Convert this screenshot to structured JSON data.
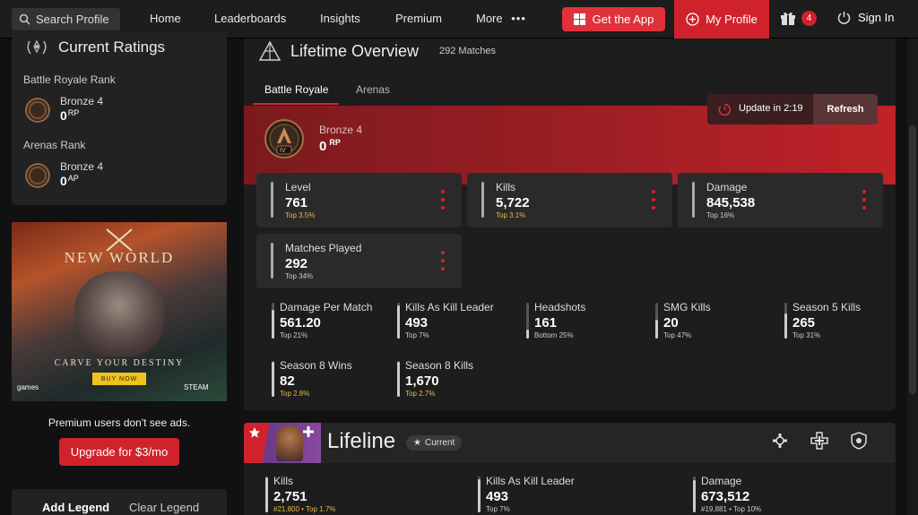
{
  "nav": {
    "search_label": "Search Profile",
    "links": [
      "Home",
      "Leaderboards",
      "Insights",
      "Premium",
      "More"
    ],
    "get_app": "Get the App",
    "my_profile": "My Profile",
    "gift_count": "4",
    "sign_in": "Sign In"
  },
  "sidebar": {
    "ratings_title": "Current Ratings",
    "br_label": "Battle Royale Rank",
    "br_rank": "Bronze 4",
    "br_value": "0",
    "br_unit": "RP",
    "arenas_label": "Arenas Rank",
    "arenas_rank": "Bronze 4",
    "arenas_value": "0",
    "arenas_unit": "AP",
    "ad": {
      "title": "NEW WORLD",
      "tagline": "CARVE YOUR DESTINY",
      "buy": "BUY NOW",
      "publisher": "games",
      "store": "STEAM"
    },
    "premium_note": "Premium users don't see ads.",
    "upgrade": "Upgrade for $3/mo",
    "add_legend": "Add Legend",
    "clear_legend": "Clear Legend"
  },
  "overview": {
    "title": "Lifetime Overview",
    "matches": "292 Matches",
    "tabs": [
      "Battle Royale",
      "Arenas"
    ],
    "update_text": "Update in 2:19",
    "refresh": "Refresh",
    "rank_name": "Bronze 4",
    "rank_value": "0",
    "rank_unit": "RP",
    "emblem_tier": "IV",
    "big_stats": [
      {
        "label": "Level",
        "value": "761",
        "rank": "Top 3.5%"
      },
      {
        "label": "Kills",
        "value": "5,722",
        "rank": "Top 3.1%"
      },
      {
        "label": "Damage",
        "value": "845,538",
        "rank": "Top 16%"
      },
      {
        "label": "Matches Played",
        "value": "292",
        "rank": "Top 34%"
      }
    ],
    "small_stats": [
      {
        "label": "Damage Per Match",
        "value": "561.20",
        "rank": "Top 21%"
      },
      {
        "label": "Kills As Kill Leader",
        "value": "493",
        "rank": "Top 7%"
      },
      {
        "label": "Headshots",
        "value": "161",
        "rank": "Bottom 25%"
      },
      {
        "label": "SMG Kills",
        "value": "20",
        "rank": "Top 47%"
      },
      {
        "label": "Season 5 Kills",
        "value": "265",
        "rank": "Top 31%"
      },
      {
        "label": "Season 8 Wins",
        "value": "82",
        "rank": "Top 2.8%"
      },
      {
        "label": "Season 8 Kills",
        "value": "1,670",
        "rank": "Top 2.7%"
      }
    ],
    "small_levels": [
      0.79,
      0.93,
      0.25,
      0.53,
      0.69,
      0.97,
      0.97
    ]
  },
  "legend": {
    "name": "Lifeline",
    "current": "Current",
    "stats": [
      {
        "label": "Kills",
        "value": "2,751",
        "rank": "#21,800 • Top 1.7%"
      },
      {
        "label": "Kills As Kill Leader",
        "value": "493",
        "rank": "Top 7%"
      },
      {
        "label": "Damage",
        "value": "673,512",
        "rank": "#19,881 • Top 10%"
      }
    ]
  },
  "colors": {
    "accent": "#d0222d",
    "gold": "#e9b84a"
  }
}
